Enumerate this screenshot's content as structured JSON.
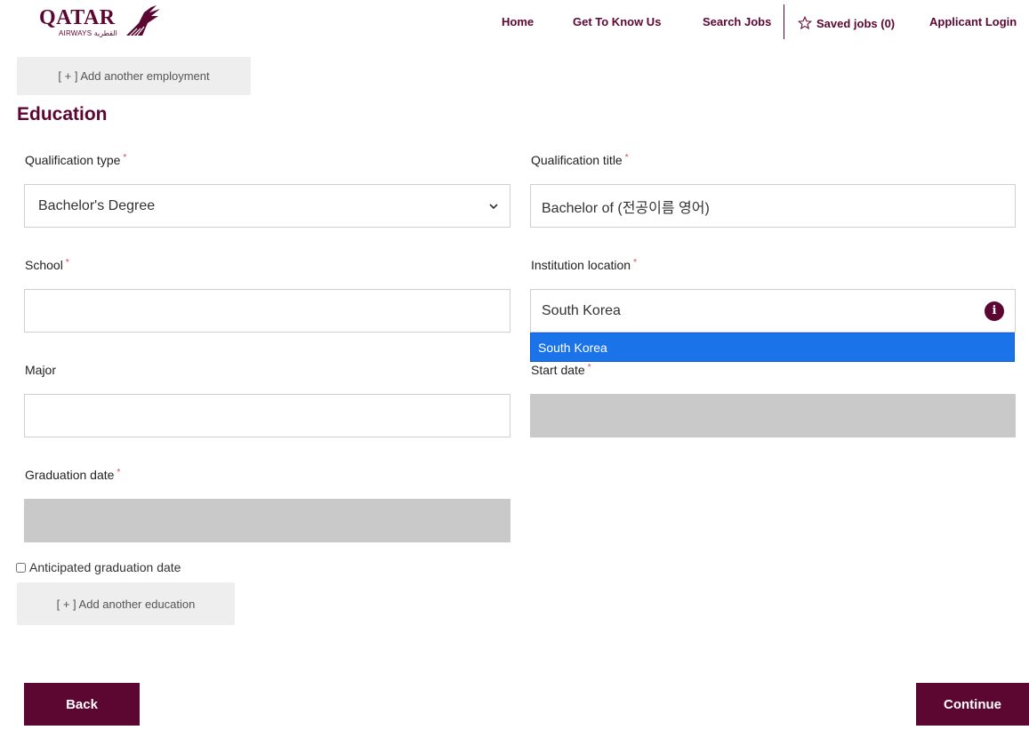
{
  "brand": {
    "logo_text": "QATAR",
    "logo_subtext": "AIRWAYS القطرية",
    "accent": "#5c0632"
  },
  "nav": {
    "home": "Home",
    "about": "Get To Know Us",
    "search": "Search Jobs",
    "saved": "Saved jobs (0)",
    "login": "Applicant Login"
  },
  "employment": {
    "add_label": "[ + ] Add another employment"
  },
  "education": {
    "title": "Education",
    "qualification_type": {
      "label": "Qualification type",
      "value": "Bachelor's Degree"
    },
    "qualification_title": {
      "label": "Qualification title",
      "value": "Bachelor of (전공이름 영어)"
    },
    "school": {
      "label": "School",
      "value": ""
    },
    "institution_location": {
      "label": "Institution location",
      "value": "South Korea",
      "option": "South Korea"
    },
    "major": {
      "label": "Major",
      "value": ""
    },
    "start_date": {
      "label": "Start date",
      "value": ""
    },
    "graduation_date": {
      "label": "Graduation date",
      "value": ""
    },
    "anticipated_label": "Anticipated graduation date",
    "add_label": "[ + ] Add another education",
    "required_mark": "*",
    "info_glyph": "i"
  },
  "actions": {
    "back": "Back",
    "continue": "Continue"
  }
}
